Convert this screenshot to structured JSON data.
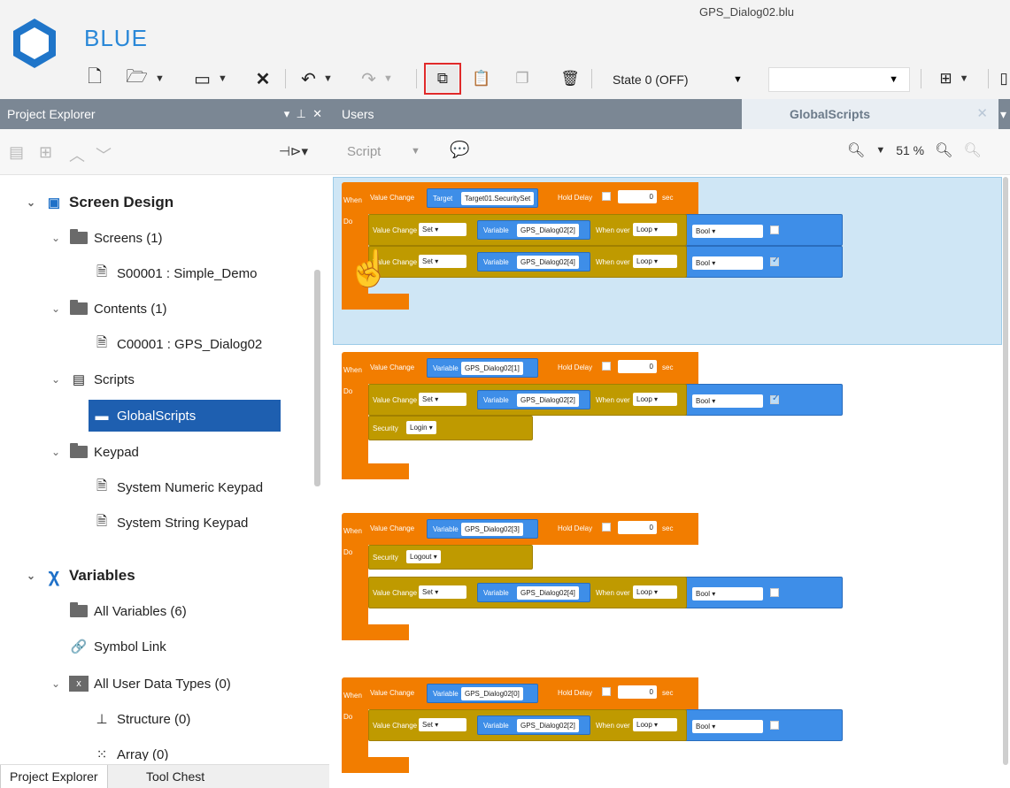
{
  "header": {
    "doc_title": "GPS_Dialog02.blu",
    "brand": "BLUE",
    "toolbar": {
      "icons": [
        "new-file-icon",
        "open-folder-icon",
        "save-icon",
        "delete-icon",
        "undo-icon",
        "redo-icon",
        "copy-icon",
        "paste-icon",
        "duplicate-icon",
        "trash-icon",
        "layout-icon"
      ],
      "state_label": "State 0 (OFF)",
      "accent_highlight": "#e02a2a"
    }
  },
  "project_explorer": {
    "title": "Project Explorer",
    "pin": "⊣⊳▾",
    "tree": {
      "screen_design": "Screen Design",
      "screens": "Screens (1)",
      "screen_item": "S00001 : Simple_Demo",
      "contents": "Contents (1)",
      "content_item": "C00001 : GPS_Dialog02",
      "scripts": "Scripts",
      "global_scripts": "GlobalScripts",
      "keypad": "Keypad",
      "numeric_keypad": "System Numeric Keypad",
      "string_keypad": "System String Keypad",
      "variables": "Variables",
      "all_variables": "All Variables (6)",
      "symbol_link": "Symbol Link",
      "all_user_types": "All User Data Types (0)",
      "structure": "Structure (0)",
      "array": "Array (0)"
    },
    "bottom_tabs": [
      "Project Explorer",
      "Tool Chest"
    ]
  },
  "editor": {
    "tabs": [
      "Users",
      "GlobalScripts"
    ],
    "script_dropdown": "Script",
    "zoom": "51 %",
    "blocks": [
      {
        "when": "When",
        "do": "Do",
        "trigger": "Value Change",
        "source_kind": "Target",
        "source": "Target01.SecuritySet",
        "hold_delay": "Hold Delay",
        "delay": "0",
        "unit": "sec",
        "actions": [
          {
            "type": "value",
            "label": "Value Change",
            "op": "Set",
            "var_kind": "Variable",
            "var": "GPS_Dialog02[2]",
            "when_over": "When over",
            "loop": "Loop",
            "dtype": "Bool",
            "checked": false
          },
          {
            "type": "value",
            "label": "Value Change",
            "op": "Set",
            "var_kind": "Variable",
            "var": "GPS_Dialog02[4]",
            "when_over": "When over",
            "loop": "Loop",
            "dtype": "Bool",
            "checked": true
          }
        ]
      },
      {
        "when": "When",
        "do": "Do",
        "trigger": "Value Change",
        "source_kind": "Variable",
        "source": "GPS_Dialog02[1]",
        "hold_delay": "Hold Delay",
        "delay": "0",
        "unit": "sec",
        "actions": [
          {
            "type": "value",
            "label": "Value Change",
            "op": "Set",
            "var_kind": "Variable",
            "var": "GPS_Dialog02[2]",
            "when_over": "When over",
            "loop": "Loop",
            "dtype": "Bool",
            "checked": true
          },
          {
            "type": "security",
            "label": "Security",
            "value": "Login"
          }
        ]
      },
      {
        "when": "When",
        "do": "Do",
        "trigger": "Value Change",
        "source_kind": "Variable",
        "source": "GPS_Dialog02[3]",
        "hold_delay": "Hold Delay",
        "delay": "0",
        "unit": "sec",
        "actions": [
          {
            "type": "security",
            "label": "Security",
            "value": "Logout"
          },
          {
            "type": "value",
            "label": "Value Change",
            "op": "Set",
            "var_kind": "Variable",
            "var": "GPS_Dialog02[4]",
            "when_over": "When over",
            "loop": "Loop",
            "dtype": "Bool",
            "checked": false
          }
        ]
      },
      {
        "when": "When",
        "do": "Do",
        "trigger": "Value Change",
        "source_kind": "Variable",
        "source": "GPS_Dialog02[0]",
        "hold_delay": "Hold Delay",
        "delay": "0",
        "unit": "sec",
        "actions": [
          {
            "type": "value",
            "label": "Value Change",
            "op": "Set",
            "var_kind": "Variable",
            "var": "GPS_Dialog02[2]",
            "when_over": "When over",
            "loop": "Loop",
            "dtype": "Bool",
            "checked": false
          }
        ]
      }
    ]
  }
}
